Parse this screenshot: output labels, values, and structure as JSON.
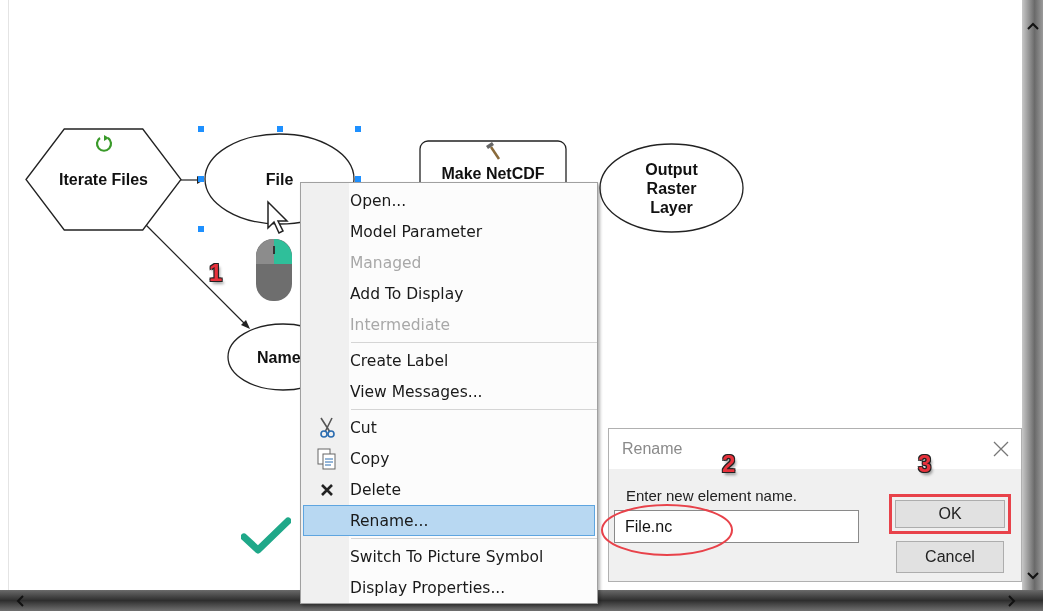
{
  "nodes": [
    {
      "kind": "iterator",
      "label": "Iterate Files",
      "selected": false
    },
    {
      "kind": "variable",
      "label": "File",
      "selected": true
    },
    {
      "kind": "tool",
      "label": "Make NetCDF",
      "selected": false
    },
    {
      "kind": "variable",
      "label": "Output Raster Layer",
      "selected": false
    },
    {
      "kind": "variable",
      "label": "Name",
      "selected": false
    }
  ],
  "callouts": [
    "1",
    "2",
    "3"
  ],
  "context_menu": {
    "groups": [
      [
        {
          "label": "Open...",
          "disabled": false,
          "selected": false
        },
        {
          "label": "Model Parameter",
          "disabled": false,
          "selected": false
        },
        {
          "label": "Managed",
          "disabled": true,
          "selected": false
        },
        {
          "label": "Add To Display",
          "disabled": false,
          "selected": false
        },
        {
          "label": "Intermediate",
          "disabled": true,
          "selected": false
        }
      ],
      [
        {
          "label": "Create Label",
          "disabled": false,
          "selected": false
        },
        {
          "label": "View Messages...",
          "disabled": false,
          "selected": false
        }
      ],
      [
        {
          "label": "Cut",
          "disabled": false,
          "selected": false
        },
        {
          "label": "Copy",
          "disabled": false,
          "selected": false
        },
        {
          "label": "Delete",
          "disabled": false,
          "selected": false
        },
        {
          "label": "Rename...",
          "disabled": false,
          "selected": true
        }
      ],
      [
        {
          "label": "Switch To Picture Symbol",
          "disabled": false,
          "selected": false
        },
        {
          "label": "Display Properties...",
          "disabled": false,
          "selected": false
        }
      ]
    ]
  },
  "dialog": {
    "title": "Rename",
    "prompt": "Enter new element name.",
    "value": "File.nc",
    "buttons": [
      {
        "label": "OK",
        "highlighted": true
      },
      {
        "label": "Cancel",
        "highlighted": false
      }
    ]
  }
}
